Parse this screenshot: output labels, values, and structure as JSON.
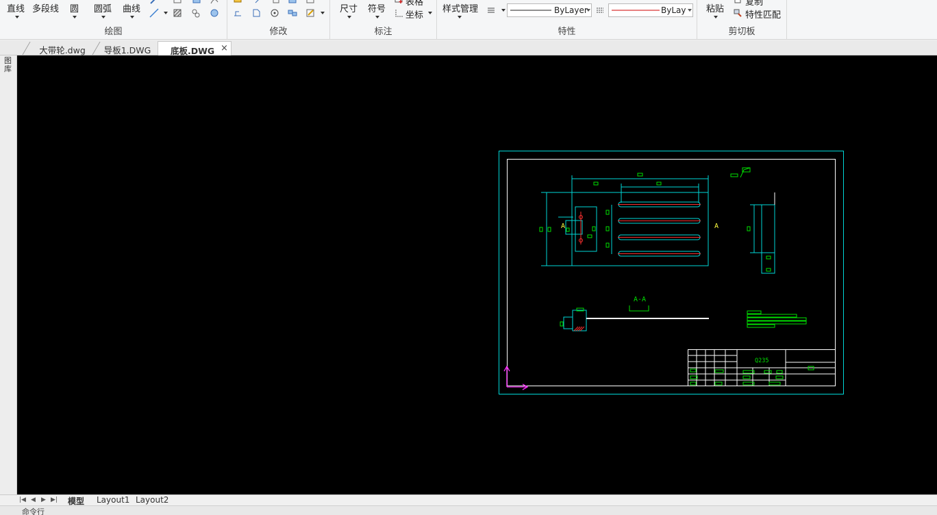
{
  "ribbon": {
    "draw": {
      "title": "绘图",
      "line": "直线",
      "polyline": "多段线",
      "circle": "圆",
      "arc": "圆弧",
      "curve": "曲线"
    },
    "modify": {
      "title": "修改"
    },
    "annotate": {
      "title": "标注",
      "dimension": "尺寸",
      "symbol": "符号",
      "table": "表格",
      "coordinate": "坐标"
    },
    "properties": {
      "title": "特性",
      "style_manager": "样式管理",
      "linetype_value": "ByLayer",
      "color_value": "ByLaye"
    },
    "clipboard": {
      "title": "剪切板",
      "paste": "粘贴",
      "copy": "复制",
      "match_properties": "特性匹配"
    }
  },
  "left_strip": {
    "label": "图库"
  },
  "document_tabs": [
    {
      "label": "大带轮.dwg",
      "active": false
    },
    {
      "label": "导板1.DWG",
      "active": false
    },
    {
      "label": "底板.DWG",
      "active": true
    }
  ],
  "drawing": {
    "section_label": "A-A",
    "view_marker_a": "A",
    "material": "Q235",
    "colors": {
      "frame_outer": "#00d8d8",
      "frame_inner": "#ffffff",
      "dimension": "#00e000",
      "geometry_cyan": "#00d8d8",
      "centerline": "#ff3030",
      "ucs": "#ff30ff",
      "text_yellow": "#ffff40"
    }
  },
  "layout_tabs": [
    {
      "label": "模型",
      "active": true
    },
    {
      "label": "Layout1",
      "active": false
    },
    {
      "label": "Layout2",
      "active": false
    }
  ],
  "command_line": {
    "text": "命令行"
  }
}
